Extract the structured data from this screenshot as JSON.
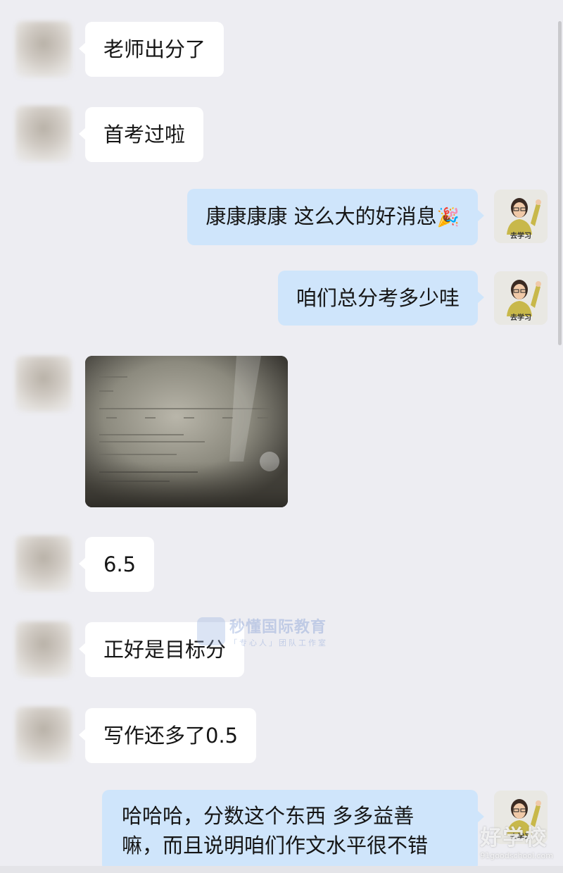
{
  "messages": [
    {
      "side": "left",
      "text": "老师出分了"
    },
    {
      "side": "left",
      "text": "首考过啦"
    },
    {
      "side": "right",
      "text": "康康康康 这么大的好消息",
      "emoji": "🎉"
    },
    {
      "side": "right",
      "text": "咱们总分考多少哇"
    },
    {
      "side": "left",
      "type": "image",
      "image_caption": "score screenshot photo"
    },
    {
      "side": "left",
      "text": "6.5"
    },
    {
      "side": "left",
      "text": "正好是目标分"
    },
    {
      "side": "left",
      "text": "写作还多了0.5"
    },
    {
      "side": "right",
      "lines": [
        "哈哈哈，分数这个东西 多多益善",
        "嘛，而且说明咱们作文水平很不错"
      ]
    }
  ],
  "self_avatar": {
    "caption": "去学习",
    "icon": "teacher-avatar"
  },
  "watermark": {
    "title": "秒懂国际教育",
    "subtitle": "「专心人」团队工作室"
  },
  "corner_watermark": {
    "text": "好学校",
    "url": "91goodschool.com"
  },
  "colors": {
    "background": "#ededf2",
    "incoming_bubble": "#ffffff",
    "outgoing_bubble": "#cfe5fb"
  }
}
